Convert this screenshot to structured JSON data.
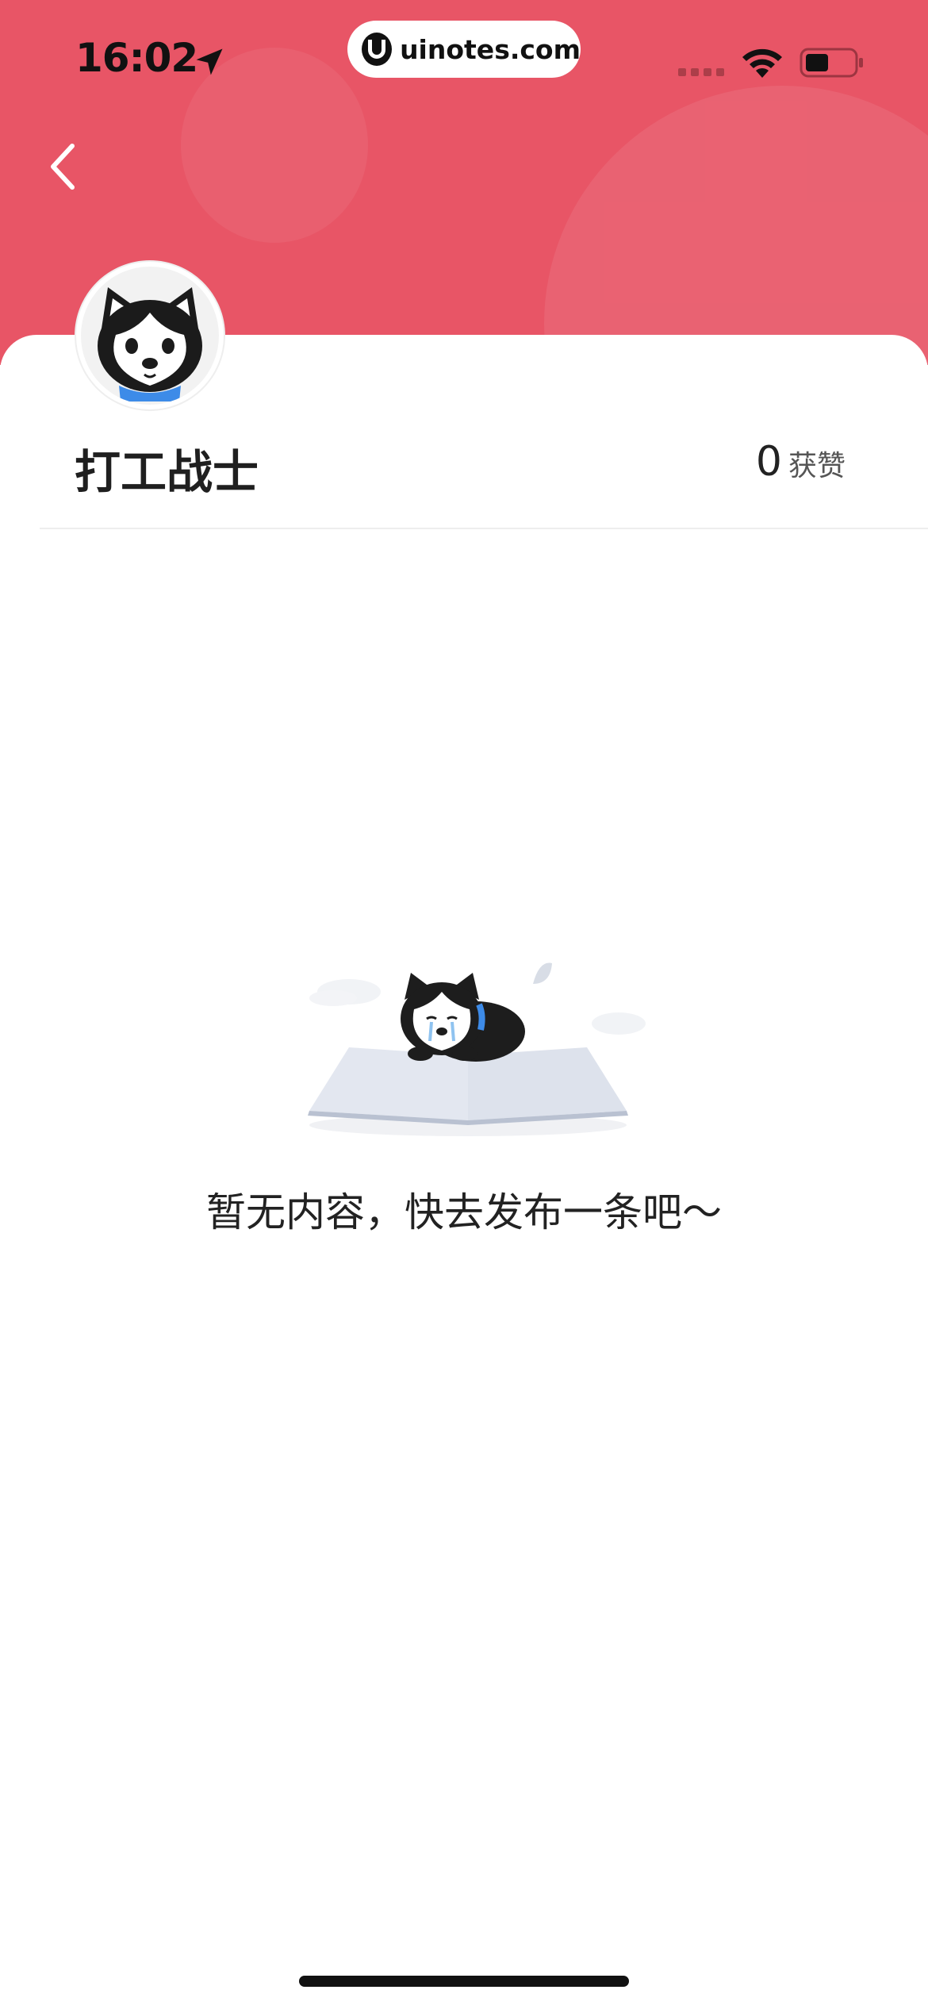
{
  "status_bar": {
    "time": "16:02",
    "url": "uinotes.com"
  },
  "header": {
    "background_color": "#e85566",
    "back_icon": "chevron-left-icon"
  },
  "profile": {
    "name": "打工战士",
    "likes_count": "0",
    "likes_label": "获赞"
  },
  "empty_state": {
    "message": "暂无内容，快去发布一条吧～",
    "illustration": "husky-on-book-illustration"
  }
}
